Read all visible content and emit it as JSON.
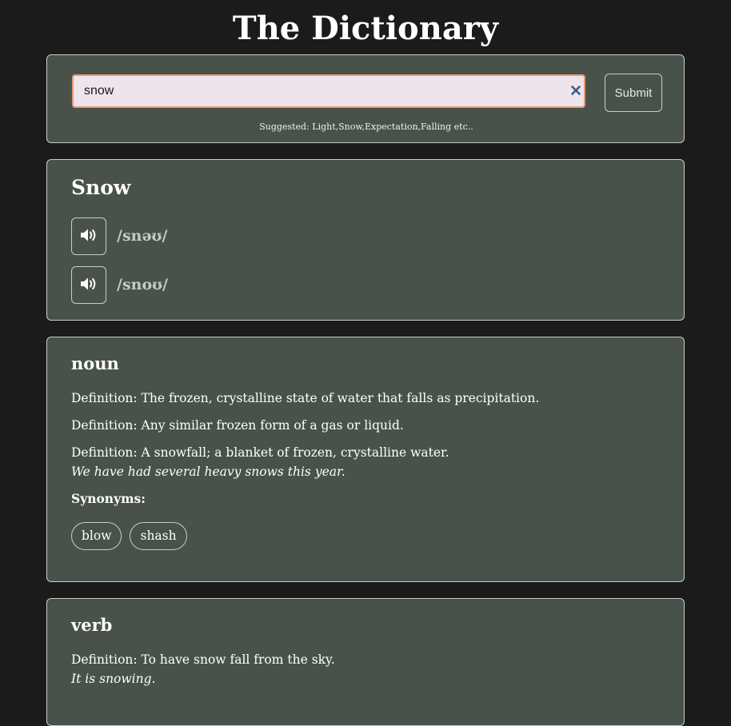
{
  "header": {
    "title": "The Dictionary"
  },
  "search": {
    "value": "snow",
    "placeholder": "",
    "clear_icon": "close-icon",
    "submit_label": "Submit",
    "suggested": "Suggested: Light,Snow,Expectation,Falling etc.."
  },
  "word": {
    "title": "Snow",
    "phonetics": [
      {
        "icon": "speaker-icon",
        "text": "/snəʊ/"
      },
      {
        "icon": "speaker-icon",
        "text": "/snoʊ/"
      }
    ]
  },
  "meanings": [
    {
      "part_of_speech": "noun",
      "definitions": [
        {
          "text": "Definition: The frozen, crystalline state of water that falls as precipitation.",
          "example": ""
        },
        {
          "text": "Definition: Any similar frozen form of a gas or liquid.",
          "example": ""
        },
        {
          "text": "Definition: A snowfall; a blanket of frozen, crystalline water.",
          "example": "We have had several heavy snows this year."
        }
      ],
      "synonyms_label": "Synonyms:",
      "synonyms": [
        "blow",
        "shash"
      ]
    },
    {
      "part_of_speech": "verb",
      "definitions": [
        {
          "text": "Definition: To have snow fall from the sky.",
          "example": "It is snowing."
        }
      ]
    }
  ],
  "colors": {
    "background": "#1b1b1b",
    "card": "#49524a",
    "card_border": "#c9ccc9",
    "input_bg": "#ede4ec",
    "input_focus_border": "#e89a72",
    "clear_icon": "#3a5a8c"
  }
}
